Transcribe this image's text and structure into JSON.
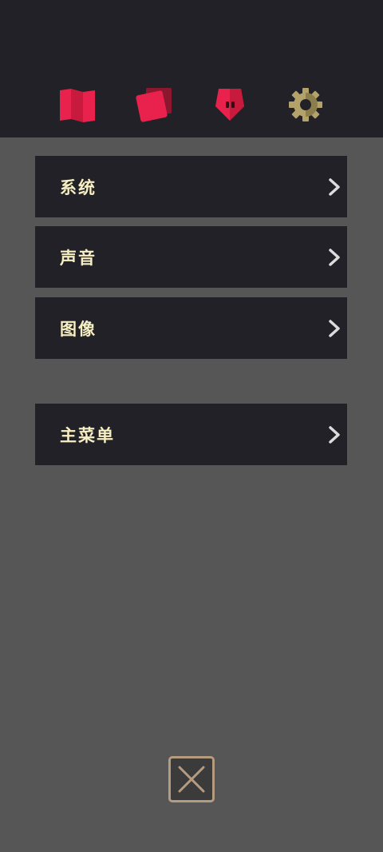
{
  "tabs": [
    {
      "icon": "map-icon",
      "color": "#e8224c"
    },
    {
      "icon": "cards-icon",
      "color": "#e8224c"
    },
    {
      "icon": "creature-icon",
      "color": "#e8224c"
    },
    {
      "icon": "gear-icon",
      "color": "#b3a36a"
    }
  ],
  "menu": {
    "items": [
      {
        "label": "系统"
      },
      {
        "label": "声音"
      },
      {
        "label": "图像"
      },
      {
        "label": "主菜单"
      }
    ]
  },
  "colors": {
    "panel_bg": "#565656",
    "item_bg": "#212127",
    "label": "#f7efc4",
    "accent_red": "#e8224c",
    "gear_gold": "#b3a36a",
    "close_border": "#b59c80"
  }
}
